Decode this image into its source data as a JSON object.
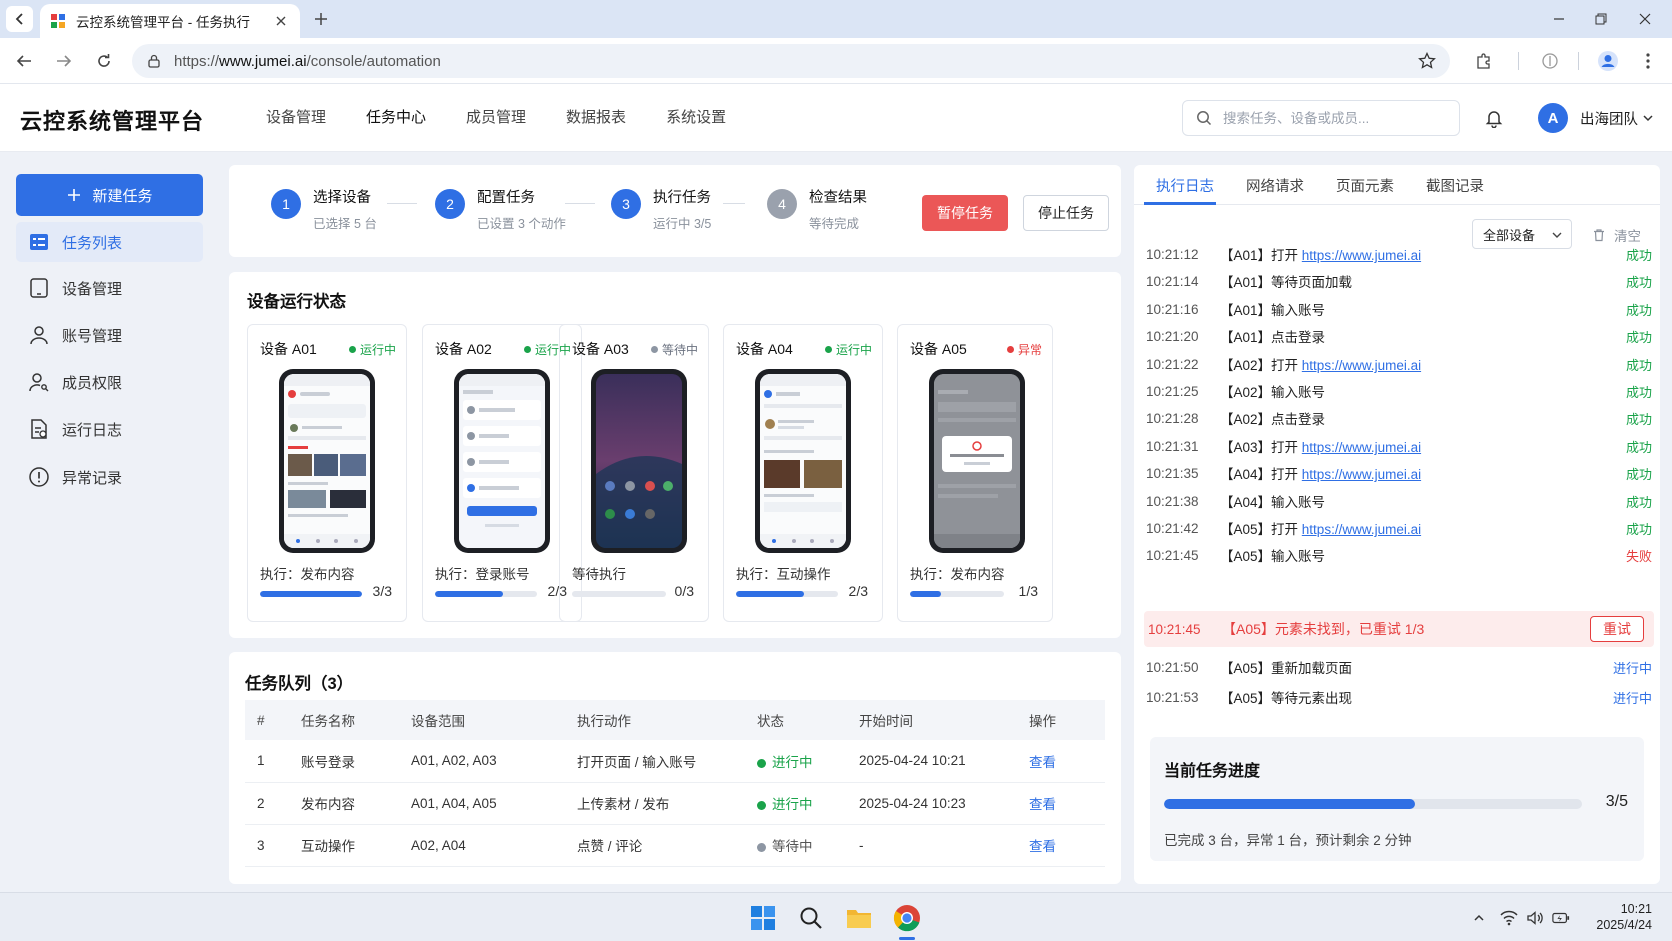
{
  "browser": {
    "tab_title": "云控系统管理平台 - 任务执行",
    "url_prefix": "https://",
    "url_host": "www.jumei.ai",
    "url_path": "/console/automation"
  },
  "app": {
    "brand": "云控系统管理平台",
    "nav": [
      "设备管理",
      "任务中心",
      "成员管理",
      "数据报表",
      "系统设置"
    ],
    "search_placeholder": "搜索任务、设备或成员...",
    "avatar_letter": "A",
    "team": "出海团队"
  },
  "sidebar": {
    "new_task": "新建任务",
    "items": [
      {
        "label": "任务列表",
        "icon": "task-list-icon"
      },
      {
        "label": "设备管理",
        "icon": "tablet-icon"
      },
      {
        "label": "账号管理",
        "icon": "user-icon"
      },
      {
        "label": "成员权限",
        "icon": "user-key-icon"
      },
      {
        "label": "运行日志",
        "icon": "log-file-icon"
      },
      {
        "label": "异常记录",
        "icon": "alert-circle-icon"
      }
    ]
  },
  "steps": [
    {
      "num": "1",
      "title": "选择设备",
      "sub": "已选择 5 台"
    },
    {
      "num": "2",
      "title": "配置任务",
      "sub": "已设置 3 个动作"
    },
    {
      "num": "3",
      "title": "执行任务",
      "sub": "运行中 3/5"
    },
    {
      "num": "4",
      "title": "检查结果",
      "sub": "等待完成"
    }
  ],
  "actions": {
    "pause": "暂停任务",
    "stop": "停止任务"
  },
  "devices": {
    "title": "设备运行状态",
    "items": [
      {
        "name": "设备 A01",
        "status": "运行中",
        "task": "执行：发布内容",
        "done": 3,
        "total": 3,
        "count": "3/3"
      },
      {
        "name": "设备 A02",
        "status": "运行中",
        "task": "执行：登录账号",
        "done": 2,
        "total": 3,
        "count": "2/3"
      },
      {
        "name": "设备 A03",
        "status": "等待中",
        "task": "等待执行",
        "done": 0,
        "total": 3,
        "count": "0/3"
      },
      {
        "name": "设备 A04",
        "status": "运行中",
        "task": "执行：互动操作",
        "done": 2,
        "total": 3,
        "count": "2/3"
      },
      {
        "name": "设备 A05",
        "status": "异常",
        "task": "执行：发布内容",
        "done": 1,
        "total": 3,
        "count": "1/3"
      }
    ]
  },
  "queue": {
    "title": "任务队列（3）",
    "headers": [
      "#",
      "任务名称",
      "设备范围",
      "执行动作",
      "状态",
      "开始时间",
      "操作"
    ],
    "rows": [
      {
        "no": "1",
        "name": "账号登录",
        "devices": "A01, A02, A03",
        "action": "打开页面 / 输入账号",
        "status": "进行中",
        "start": "2025-04-24 10:21",
        "op": "查看"
      },
      {
        "no": "2",
        "name": "发布内容",
        "devices": "A01, A04, A05",
        "action": "上传素材 / 发布",
        "status": "进行中",
        "start": "2025-04-24 10:23",
        "op": "查看"
      },
      {
        "no": "3",
        "name": "互动操作",
        "devices": "A02, A04",
        "action": "点赞 / 评论",
        "status": "等待中",
        "start": "-",
        "op": "查看"
      }
    ]
  },
  "logs": {
    "tabs": [
      "执行日志",
      "网络请求",
      "页面元素",
      "截图记录"
    ],
    "filter": "全部设备",
    "clear": "清空",
    "entries": [
      {
        "time": "10:21:12",
        "dev": "【A01】",
        "text": "打开 ",
        "url": "https://www.jumei.ai",
        "result": "成功"
      },
      {
        "time": "10:21:14",
        "dev": "【A01】",
        "text": "等待页面加载",
        "url": "",
        "result": "成功"
      },
      {
        "time": "10:21:16",
        "dev": "【A01】",
        "text": "输入账号",
        "url": "",
        "result": "成功"
      },
      {
        "time": "10:21:20",
        "dev": "【A01】",
        "text": "点击登录",
        "url": "",
        "result": "成功"
      },
      {
        "time": "10:21:22",
        "dev": "【A02】",
        "text": "打开 ",
        "url": "https://www.jumei.ai",
        "result": "成功"
      },
      {
        "time": "10:21:25",
        "dev": "【A02】",
        "text": "输入账号",
        "url": "",
        "result": "成功"
      },
      {
        "time": "10:21:28",
        "dev": "【A02】",
        "text": "点击登录",
        "url": "",
        "result": "成功"
      },
      {
        "time": "10:21:31",
        "dev": "【A03】",
        "text": "打开 ",
        "url": "https://www.jumei.ai",
        "result": "成功"
      },
      {
        "time": "10:21:35",
        "dev": "【A04】",
        "text": "打开 ",
        "url": "https://www.jumei.ai",
        "result": "成功"
      },
      {
        "time": "10:21:38",
        "dev": "【A04】",
        "text": "输入账号",
        "url": "",
        "result": "成功"
      },
      {
        "time": "10:21:42",
        "dev": "【A05】",
        "text": "打开 ",
        "url": "https://www.jumei.ai",
        "result": "成功"
      },
      {
        "time": "10:21:45",
        "dev": "【A05】",
        "text": "输入账号",
        "url": "",
        "result": "失败"
      }
    ],
    "error": {
      "time": "10:21:45",
      "text": "【A05】元素未找到，已重试 1/3",
      "retry": "重试"
    },
    "after": [
      {
        "time": "10:21:50",
        "text": "【A05】重新加载页面",
        "result": "进行中"
      },
      {
        "time": "10:21:53",
        "text": "【A05】等待元素出现",
        "result": "进行中"
      }
    ]
  },
  "progress": {
    "title": "当前任务进度",
    "done": 3,
    "total": 5,
    "value": "3/5",
    "detail": "已完成 3 台，异常 1 台，预计剩余 2 分钟"
  },
  "taskbar": {
    "time": "10:21",
    "date": "2025/4/24"
  },
  "colors": {
    "primary": "#2f6fe4",
    "success": "#1aa34a",
    "danger": "#e53e3e",
    "waiting": "#8d96a3"
  }
}
